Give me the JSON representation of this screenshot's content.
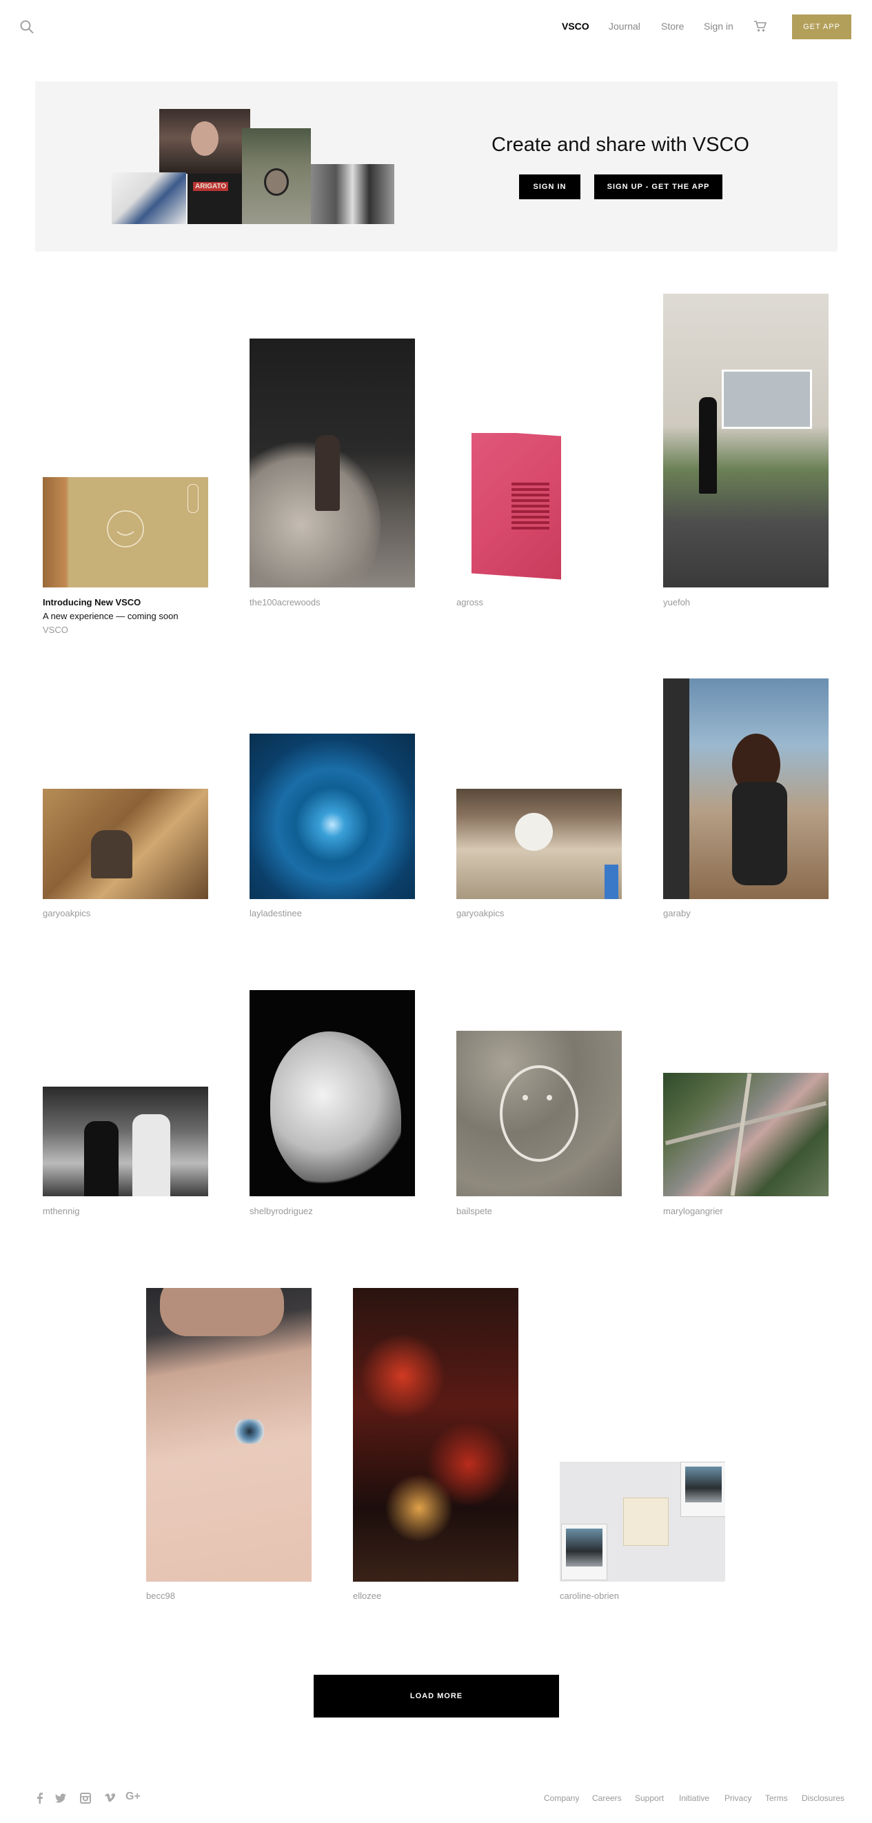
{
  "header": {
    "nav": [
      "VSCO",
      "Journal",
      "Store",
      "Sign in"
    ],
    "get_app": "GET APP",
    "icons": {
      "search": "search-icon",
      "cart": "cart-icon"
    },
    "accent": "#b29f5a"
  },
  "hero": {
    "title": "Create and share with VSCO",
    "sign_in": "SIGN IN",
    "sign_up": "SIGN UP - GET THE APP",
    "collage_text": "ARIGATO"
  },
  "featured": {
    "title": "Introducing New VSCO",
    "subtitle": "A new experience — coming soon",
    "author": "VSCO"
  },
  "grid": {
    "users": [
      "the100acrewoods",
      "agross",
      "yuefoh",
      "garyoakpics",
      "layladestinee",
      "garyoakpics",
      "garaby",
      "mthennig",
      "shelbyrodriguez",
      "bailspete",
      "marylogangrier",
      "becc98",
      "ellozee",
      "caroline-obrien"
    ]
  },
  "load_more": "LOAD MORE",
  "footer": {
    "social": [
      "facebook-icon",
      "twitter-icon",
      "instagram-icon",
      "vimeo-icon",
      "google-plus-icon"
    ],
    "google_plus_label": "G+",
    "links": [
      "Company",
      "Careers",
      "Support",
      "Initiative",
      "Privacy",
      "Terms",
      "Disclosures"
    ]
  }
}
